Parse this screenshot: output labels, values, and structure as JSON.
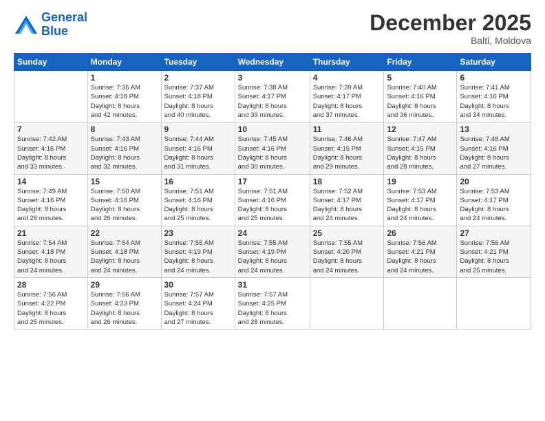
{
  "logo": {
    "line1": "General",
    "line2": "Blue"
  },
  "title": "December 2025",
  "subtitle": "Balti, Moldova",
  "days_of_week": [
    "Sunday",
    "Monday",
    "Tuesday",
    "Wednesday",
    "Thursday",
    "Friday",
    "Saturday"
  ],
  "weeks": [
    [
      {
        "day": "",
        "info": ""
      },
      {
        "day": "1",
        "info": "Sunrise: 7:35 AM\nSunset: 4:18 PM\nDaylight: 8 hours\nand 42 minutes."
      },
      {
        "day": "2",
        "info": "Sunrise: 7:37 AM\nSunset: 4:18 PM\nDaylight: 8 hours\nand 40 minutes."
      },
      {
        "day": "3",
        "info": "Sunrise: 7:38 AM\nSunset: 4:17 PM\nDaylight: 8 hours\nand 39 minutes."
      },
      {
        "day": "4",
        "info": "Sunrise: 7:39 AM\nSunset: 4:17 PM\nDaylight: 8 hours\nand 37 minutes."
      },
      {
        "day": "5",
        "info": "Sunrise: 7:40 AM\nSunset: 4:16 PM\nDaylight: 8 hours\nand 36 minutes."
      },
      {
        "day": "6",
        "info": "Sunrise: 7:41 AM\nSunset: 4:16 PM\nDaylight: 8 hours\nand 34 minutes."
      }
    ],
    [
      {
        "day": "7",
        "info": "Sunrise: 7:42 AM\nSunset: 4:16 PM\nDaylight: 8 hours\nand 33 minutes."
      },
      {
        "day": "8",
        "info": "Sunrise: 7:43 AM\nSunset: 4:16 PM\nDaylight: 8 hours\nand 32 minutes."
      },
      {
        "day": "9",
        "info": "Sunrise: 7:44 AM\nSunset: 4:16 PM\nDaylight: 8 hours\nand 31 minutes."
      },
      {
        "day": "10",
        "info": "Sunrise: 7:45 AM\nSunset: 4:16 PM\nDaylight: 8 hours\nand 30 minutes."
      },
      {
        "day": "11",
        "info": "Sunrise: 7:46 AM\nSunset: 4:15 PM\nDaylight: 8 hours\nand 29 minutes."
      },
      {
        "day": "12",
        "info": "Sunrise: 7:47 AM\nSunset: 4:15 PM\nDaylight: 8 hours\nand 28 minutes."
      },
      {
        "day": "13",
        "info": "Sunrise: 7:48 AM\nSunset: 4:16 PM\nDaylight: 8 hours\nand 27 minutes."
      }
    ],
    [
      {
        "day": "14",
        "info": "Sunrise: 7:49 AM\nSunset: 4:16 PM\nDaylight: 8 hours\nand 26 minutes."
      },
      {
        "day": "15",
        "info": "Sunrise: 7:50 AM\nSunset: 4:16 PM\nDaylight: 8 hours\nand 26 minutes."
      },
      {
        "day": "16",
        "info": "Sunrise: 7:51 AM\nSunset: 4:16 PM\nDaylight: 8 hours\nand 25 minutes."
      },
      {
        "day": "17",
        "info": "Sunrise: 7:51 AM\nSunset: 4:16 PM\nDaylight: 8 hours\nand 25 minutes."
      },
      {
        "day": "18",
        "info": "Sunrise: 7:52 AM\nSunset: 4:17 PM\nDaylight: 8 hours\nand 24 minutes."
      },
      {
        "day": "19",
        "info": "Sunrise: 7:53 AM\nSunset: 4:17 PM\nDaylight: 8 hours\nand 24 minutes."
      },
      {
        "day": "20",
        "info": "Sunrise: 7:53 AM\nSunset: 4:17 PM\nDaylight: 8 hours\nand 24 minutes."
      }
    ],
    [
      {
        "day": "21",
        "info": "Sunrise: 7:54 AM\nSunset: 4:18 PM\nDaylight: 8 hours\nand 24 minutes."
      },
      {
        "day": "22",
        "info": "Sunrise: 7:54 AM\nSunset: 4:18 PM\nDaylight: 8 hours\nand 24 minutes."
      },
      {
        "day": "23",
        "info": "Sunrise: 7:55 AM\nSunset: 4:19 PM\nDaylight: 8 hours\nand 24 minutes."
      },
      {
        "day": "24",
        "info": "Sunrise: 7:55 AM\nSunset: 4:19 PM\nDaylight: 8 hours\nand 24 minutes."
      },
      {
        "day": "25",
        "info": "Sunrise: 7:55 AM\nSunset: 4:20 PM\nDaylight: 8 hours\nand 24 minutes."
      },
      {
        "day": "26",
        "info": "Sunrise: 7:56 AM\nSunset: 4:21 PM\nDaylight: 8 hours\nand 24 minutes."
      },
      {
        "day": "27",
        "info": "Sunrise: 7:56 AM\nSunset: 4:21 PM\nDaylight: 8 hours\nand 25 minutes."
      }
    ],
    [
      {
        "day": "28",
        "info": "Sunrise: 7:56 AM\nSunset: 4:22 PM\nDaylight: 8 hours\nand 25 minutes."
      },
      {
        "day": "29",
        "info": "Sunrise: 7:56 AM\nSunset: 4:23 PM\nDaylight: 8 hours\nand 26 minutes."
      },
      {
        "day": "30",
        "info": "Sunrise: 7:57 AM\nSunset: 4:24 PM\nDaylight: 8 hours\nand 27 minutes."
      },
      {
        "day": "31",
        "info": "Sunrise: 7:57 AM\nSunset: 4:25 PM\nDaylight: 8 hours\nand 28 minutes."
      },
      {
        "day": "",
        "info": ""
      },
      {
        "day": "",
        "info": ""
      },
      {
        "day": "",
        "info": ""
      }
    ]
  ]
}
